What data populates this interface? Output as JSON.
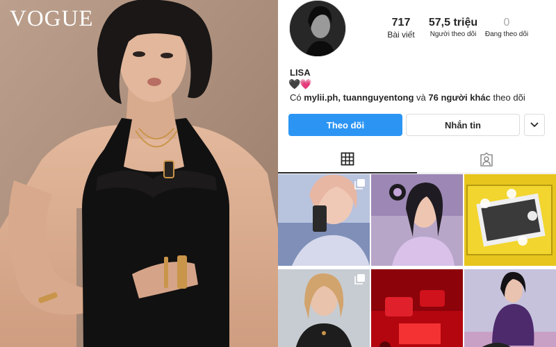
{
  "magazine": {
    "logo": "VOGUE"
  },
  "profile": {
    "username": "LISA",
    "bio": "🖤💗",
    "stats": {
      "posts": {
        "value": "717",
        "label": "Bài viết"
      },
      "followers": {
        "value": "57,5 triệu",
        "label": "Người theo dõi"
      },
      "following": {
        "value": "0",
        "label": "Đang theo dõi"
      }
    },
    "followed_by": {
      "prefix": "Có ",
      "names": "mylii.ph, tuannguyentong",
      "middle": " và ",
      "others": "76 người khác",
      "suffix": " theo dõi"
    },
    "buttons": {
      "follow": "Theo dõi",
      "message": "Nhắn tin"
    }
  },
  "tabs": [
    {
      "name": "grid",
      "icon": "grid-icon",
      "active": true
    },
    {
      "name": "tagged",
      "icon": "tagged-person-icon",
      "active": false
    }
  ],
  "colors": {
    "accent": "#2c95f4",
    "text": "#262626",
    "border": "#dbdbdb"
  },
  "posts": [
    {
      "id": 1,
      "multi": true
    },
    {
      "id": 2,
      "multi": false
    },
    {
      "id": 3,
      "multi": false
    },
    {
      "id": 4,
      "multi": true
    },
    {
      "id": 5,
      "multi": false
    },
    {
      "id": 6,
      "multi": false
    }
  ]
}
